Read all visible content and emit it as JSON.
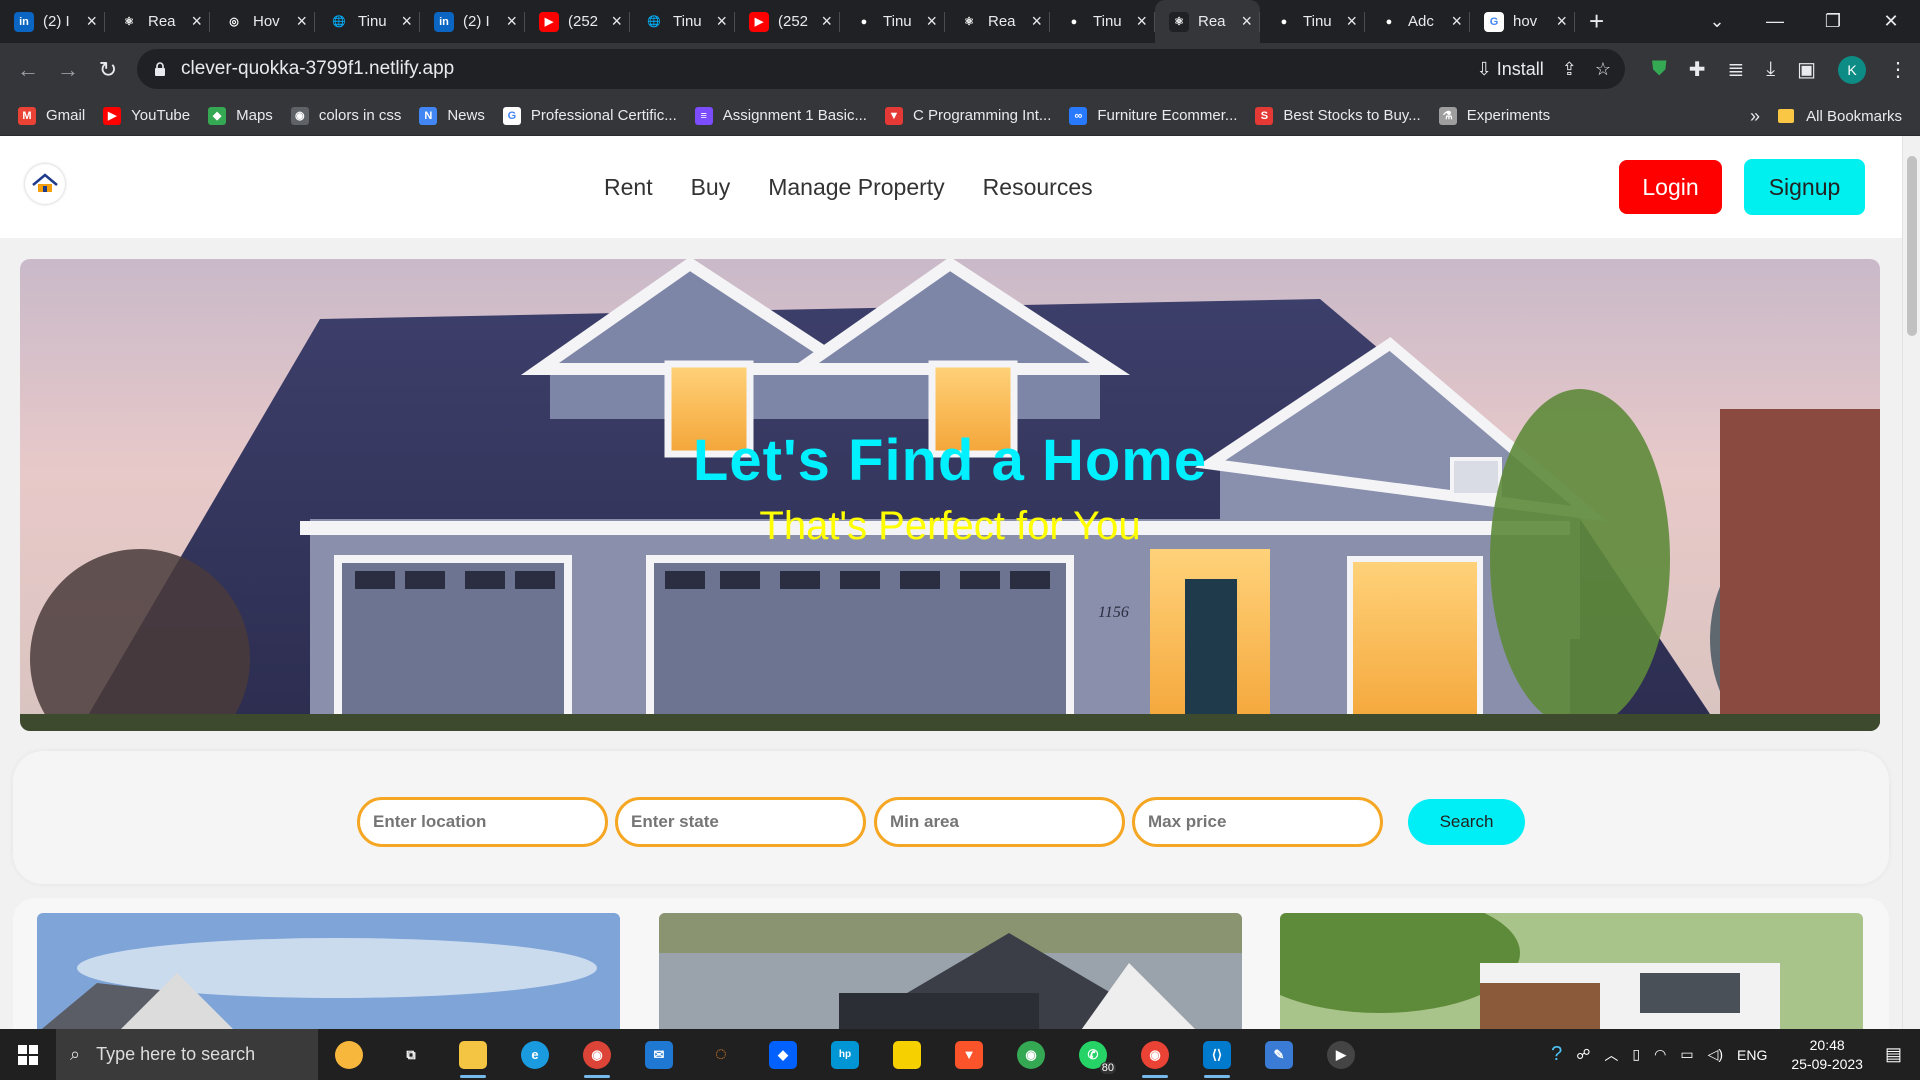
{
  "browser": {
    "tabs": [
      {
        "title": "(2) I",
        "icon": "linkedin-icon",
        "color": "#0a66c2",
        "glyph": "in"
      },
      {
        "title": "Rea",
        "icon": "react-icon",
        "color": "#202124",
        "glyph": "⚛"
      },
      {
        "title": "Hov",
        "icon": "openai-icon",
        "color": "#202124",
        "glyph": "◎"
      },
      {
        "title": "Tinu",
        "icon": "globe-icon",
        "color": "#202124",
        "glyph": "🌐"
      },
      {
        "title": "(2) I",
        "icon": "linkedin-icon",
        "color": "#0a66c2",
        "glyph": "in"
      },
      {
        "title": "(252",
        "icon": "youtube-icon",
        "color": "#ff0000",
        "glyph": "▶"
      },
      {
        "title": "Tinu",
        "icon": "globe-icon",
        "color": "#202124",
        "glyph": "🌐"
      },
      {
        "title": "(252",
        "icon": "youtube-icon",
        "color": "#ff0000",
        "glyph": "▶"
      },
      {
        "title": "Tinu",
        "icon": "github-icon",
        "color": "#202124",
        "glyph": "●"
      },
      {
        "title": "Rea",
        "icon": "react-icon",
        "color": "#202124",
        "glyph": "⚛"
      },
      {
        "title": "Tinu",
        "icon": "github-icon",
        "color": "#202124",
        "glyph": "●"
      },
      {
        "title": "Rea",
        "icon": "react-icon",
        "color": "#202124",
        "glyph": "⚛",
        "active": true
      },
      {
        "title": "Tinu",
        "icon": "github-icon",
        "color": "#202124",
        "glyph": "●"
      },
      {
        "title": "Adc",
        "icon": "github-icon",
        "color": "#202124",
        "glyph": "●"
      },
      {
        "title": "hov",
        "icon": "google-icon",
        "color": "#ffffff",
        "glyph": "G"
      }
    ],
    "url": "clever-quokka-3799f1.netlify.app",
    "install_label": "Install",
    "avatar_letter": "K",
    "bookmarks": [
      {
        "label": "Gmail",
        "icon": "gmail-icon",
        "color": "#ea4335",
        "glyph": "M"
      },
      {
        "label": "YouTube",
        "icon": "youtube-icon",
        "color": "#ff0000",
        "glyph": "▶"
      },
      {
        "label": "Maps",
        "icon": "maps-icon",
        "color": "#34a853",
        "glyph": "◆"
      },
      {
        "label": "colors in css",
        "icon": "globe-icon",
        "color": "#5f6368",
        "glyph": "◉"
      },
      {
        "label": "News",
        "icon": "news-icon",
        "color": "#4285f4",
        "glyph": "N"
      },
      {
        "label": "Professional Certific...",
        "icon": "google-icon",
        "color": "#ffffff",
        "glyph": "G"
      },
      {
        "label": "Assignment 1 Basic...",
        "icon": "list-icon",
        "color": "#7c4dff",
        "glyph": "≡"
      },
      {
        "label": "C Programming Int...",
        "icon": "triangle-icon",
        "color": "#e53935",
        "glyph": "▼"
      },
      {
        "label": "Furniture Ecommer...",
        "icon": "link-icon",
        "color": "#2979ff",
        "glyph": "∞"
      },
      {
        "label": "Best Stocks to Buy...",
        "icon": "stock-icon",
        "color": "#e53935",
        "glyph": "S"
      },
      {
        "label": "Experiments",
        "icon": "flask-icon",
        "color": "#9e9e9e",
        "glyph": "⚗"
      }
    ],
    "all_bookmarks": "All Bookmarks"
  },
  "site": {
    "nav": [
      "Rent",
      "Buy",
      "Manage Property",
      "Resources"
    ],
    "login": "Login",
    "signup": "Signup",
    "hero_title": "Let's Find a Home",
    "hero_subtitle": "That's Perfect for You",
    "search": {
      "location_placeholder": "Enter location",
      "state_placeholder": "Enter state",
      "area_placeholder": "Min area",
      "price_placeholder": "Max price",
      "button": "Search"
    }
  },
  "taskbar": {
    "search_placeholder": "Type here to search",
    "whatsapp_badge": "80",
    "language": "ENG",
    "time": "20:48",
    "date": "25-09-2023"
  },
  "colors": {
    "login": "#ff0000",
    "signup": "#00f0f0",
    "hero_title": "#00f0ff",
    "hero_subtitle": "#ffff00",
    "search_border": "#f5a623"
  }
}
